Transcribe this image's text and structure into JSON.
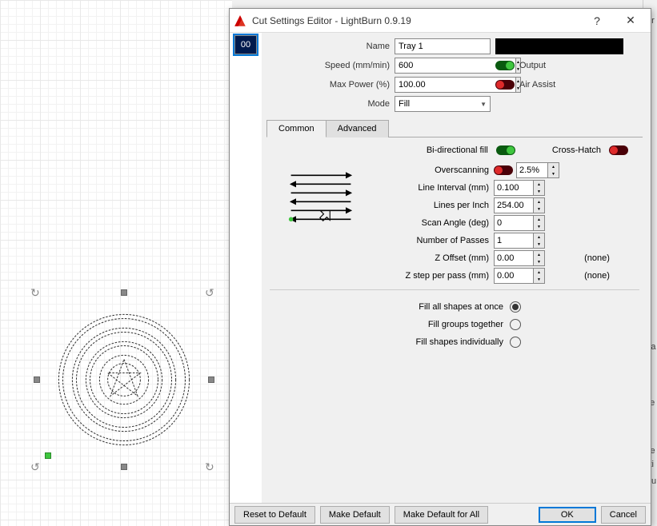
{
  "window": {
    "title": "Cut Settings Editor - LightBurn 0.9.19"
  },
  "swatch": {
    "label": "00"
  },
  "form": {
    "name_label": "Name",
    "name_value": "Tray 1",
    "speed_label": "Speed (mm/min)",
    "speed_value": "600",
    "power_label": "Max Power (%)",
    "power_value": "100.00",
    "mode_label": "Mode",
    "mode_value": "Fill",
    "output_label": "Output",
    "air_label": "Air Assist"
  },
  "tabs": {
    "common": "Common",
    "advanced": "Advanced"
  },
  "inner": {
    "bidir": "Bi-directional fill",
    "cross": "Cross-Hatch",
    "overscan_label": "Overscanning",
    "overscan_value": "2.5%",
    "interval_label": "Line Interval (mm)",
    "interval_value": "0.100",
    "lpi_label": "Lines per Inch",
    "lpi_value": "254.00",
    "angle_label": "Scan Angle (deg)",
    "angle_value": "0",
    "passes_label": "Number of Passes",
    "passes_value": "1",
    "zoff_label": "Z Offset (mm)",
    "zoff_value": "0.00",
    "zstep_label": "Z step per pass (mm)",
    "zstep_value": "0.00",
    "none": "(none)"
  },
  "radios": {
    "all": "Fill all shapes at once",
    "groups": "Fill groups together",
    "indiv": "Fill shapes individually"
  },
  "footer": {
    "reset": "Reset to Default",
    "makedef": "Make Default",
    "makeall": "Make Default for All",
    "ok": "OK",
    "cancel": "Cancel"
  },
  "sidepanel": {
    "er": "er",
    "pa": "Pa",
    "ne": "ne",
    "cte": "cte",
    "cti": "cti",
    "cu": "Cu"
  }
}
